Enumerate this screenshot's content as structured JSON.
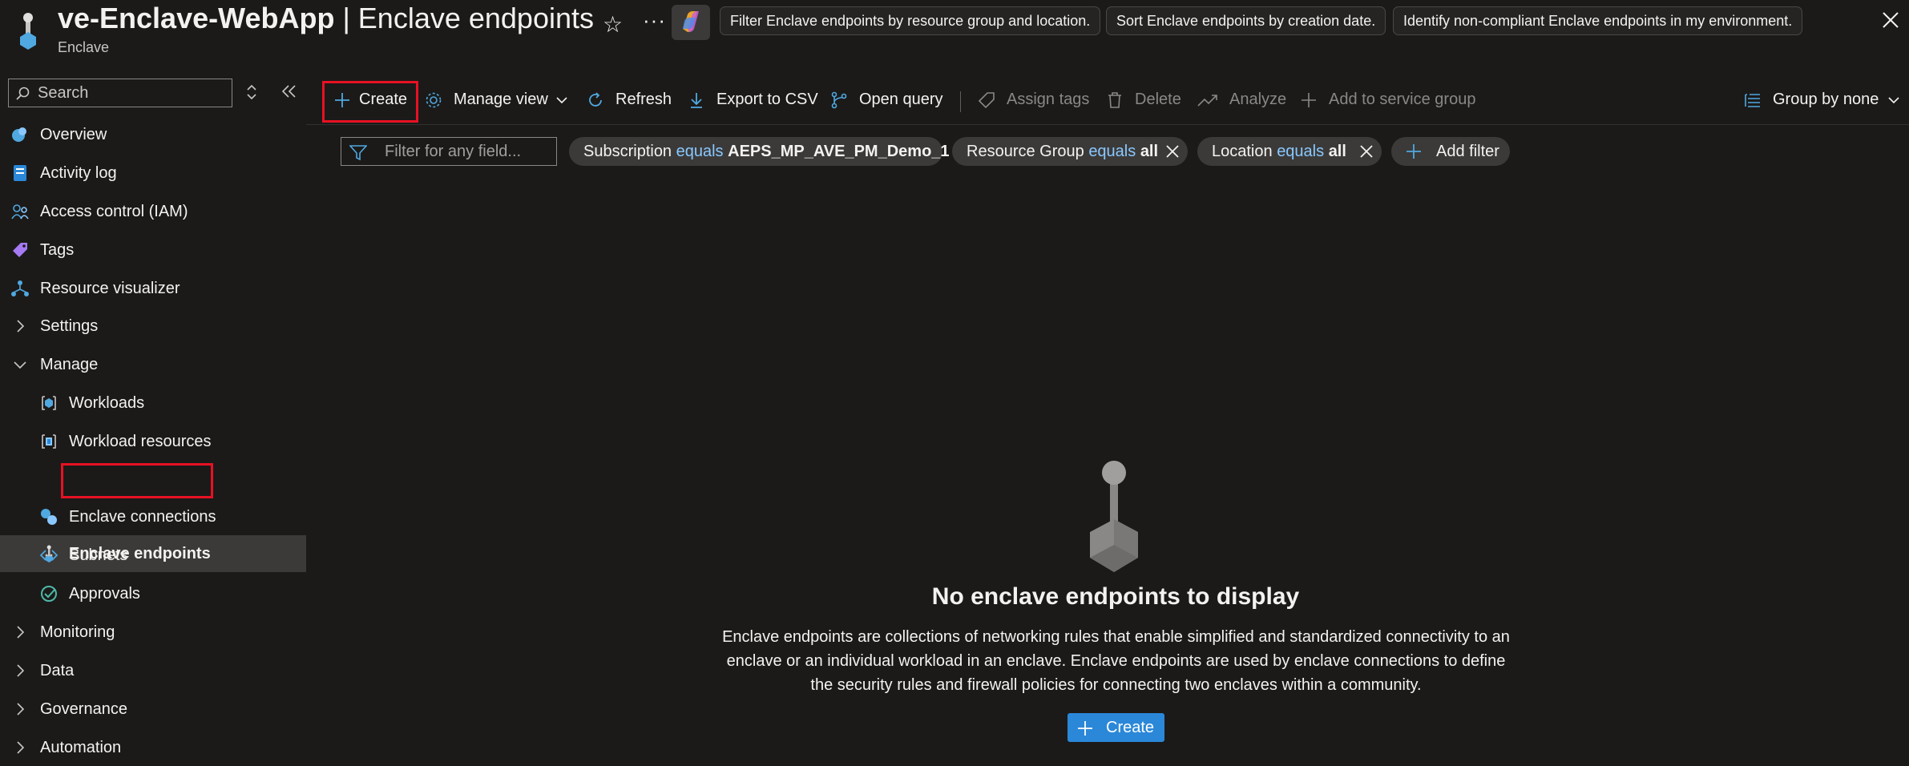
{
  "header": {
    "title_bold": "ve-Enclave-WebApp",
    "title_rest": " | Enclave endpoints",
    "subtitle": "Enclave",
    "favorite_icon": "star-icon",
    "more_icon": "ellipsis-icon",
    "prompt_chips": [
      "Filter Enclave endpoints by resource group and location.",
      "Sort Enclave endpoints by creation date.",
      "Identify non-compliant Enclave endpoints in my environment."
    ]
  },
  "sidebar": {
    "search_placeholder": "Search",
    "items": [
      {
        "label": "Overview",
        "icon": "overview-icon"
      },
      {
        "label": "Activity log",
        "icon": "activity-log-icon"
      },
      {
        "label": "Access control (IAM)",
        "icon": "iam-icon"
      },
      {
        "label": "Tags",
        "icon": "tag-icon"
      },
      {
        "label": "Resource visualizer",
        "icon": "resource-visualizer-icon"
      },
      {
        "label": "Settings",
        "icon": "chevron-right-icon"
      },
      {
        "label": "Manage",
        "icon": "chevron-down-icon"
      },
      {
        "label": "Workloads",
        "icon": "workloads-icon"
      },
      {
        "label": "Workload resources",
        "icon": "workload-resources-icon"
      },
      {
        "label": "Enclave endpoints",
        "icon": "enclave-endpoint-icon",
        "active": true
      },
      {
        "label": "Enclave connections",
        "icon": "enclave-connections-icon"
      },
      {
        "label": "Subnets",
        "icon": "subnet-icon"
      },
      {
        "label": "Approvals",
        "icon": "approvals-icon"
      },
      {
        "label": "Monitoring",
        "icon": "chevron-right-icon"
      },
      {
        "label": "Data",
        "icon": "chevron-right-icon"
      },
      {
        "label": "Governance",
        "icon": "chevron-right-icon"
      },
      {
        "label": "Automation",
        "icon": "chevron-right-icon"
      }
    ]
  },
  "toolbar": {
    "create": "Create",
    "manage_view": "Manage view",
    "refresh": "Refresh",
    "export_csv": "Export to CSV",
    "open_query": "Open query",
    "assign_tags": "Assign tags",
    "delete": "Delete",
    "analyze": "Analyze",
    "add_service_group": "Add to service group",
    "group_by": "Group by none"
  },
  "filters": {
    "placeholder": "Filter for any field...",
    "pills": [
      {
        "field": "Subscription",
        "op": "equals",
        "value": "AEPS_MP_AVE_PM_Demo_1"
      },
      {
        "field": "Resource Group",
        "op": "equals",
        "value": "all"
      },
      {
        "field": "Location",
        "op": "equals",
        "value": "all"
      }
    ],
    "add_filter": "Add filter"
  },
  "empty_state": {
    "title": "No enclave endpoints to display",
    "description": "Enclave endpoints are collections of networking rules that enable simplified and standardized connectivity to an enclave or an individual workload in an enclave. Enclave endpoints are used by enclave connections to define the security rules and firewall policies for connecting two enclaves within a community.",
    "create_label": "Create"
  },
  "colors": {
    "background": "#1b1a19",
    "accent": "#2b88d8",
    "highlight": "#e81123",
    "link_blue": "#8ac8ff"
  }
}
